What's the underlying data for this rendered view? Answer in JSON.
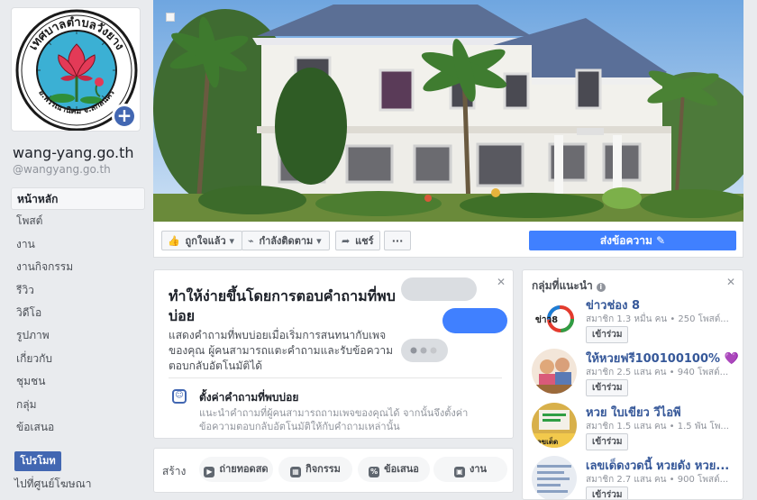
{
  "page": {
    "name": "wang-yang.go.th",
    "handle": "@wangyang.go.th",
    "logo_top_text": "เทศบาลตำบลวังยาง",
    "logo_bottom_text": "อ.พรรณานิคม จ.สกลนคร",
    "add_icon": "+"
  },
  "nav": {
    "items": [
      {
        "label": "หน้าหลัก",
        "active": true
      },
      {
        "label": "โพสต์"
      },
      {
        "label": "งาน"
      },
      {
        "label": "งานกิจกรรม"
      },
      {
        "label": "รีวิว"
      },
      {
        "label": "วิดีโอ"
      },
      {
        "label": "รูปภาพ"
      },
      {
        "label": "เกี่ยวกับ"
      },
      {
        "label": "ชุมชน"
      },
      {
        "label": "กลุ่ม"
      },
      {
        "label": "ข้อเสนอ"
      }
    ],
    "promote_label": "โปรโมท",
    "ad_center_label": "ไปที่ศูนย์โฆษณา"
  },
  "actions": {
    "like_label": "ถูกใจแล้ว",
    "follow_label": "กำลังติดตาม",
    "share_label": "แชร์",
    "more_label": "···",
    "send_message_label": "ส่งข้อความ",
    "like_icon": "👍",
    "follow_icon": "⌁",
    "share_icon": "➦",
    "send_icon": "✎",
    "dropdown_icon": "▾"
  },
  "faq": {
    "close_icon": "✕",
    "title": "ทำให้ง่ายขึ้นโดยการตอบคำถามที่พบบ่อย",
    "description": "แสดงคำถามที่พบบ่อยเมื่อเริ่มการสนทนากับเพจของคุณ ผู้คนสามารถแตะคำถามและรับข้อความตอบกลับอัตโนมัติได้",
    "sub_title": "ตั้งค่าคำถามที่พบบ่อย",
    "sub_description": "แนะนำคำถามที่ผู้คนสามารถถามเพจของคุณได้ จากนั้นจึงตั้งค่าข้อความตอบกลับอัตโนมัติให้กับคำถามเหล่านั้น",
    "chat_icon": "☺"
  },
  "create": {
    "label": "สร้าง",
    "buttons": [
      {
        "label": "ถ่ายทอดสด",
        "icon": "▶"
      },
      {
        "label": "กิจกรรม",
        "icon": "▦"
      },
      {
        "label": "ข้อเสนอ",
        "icon": "%"
      },
      {
        "label": "งาน",
        "icon": "▣"
      }
    ]
  },
  "groups": {
    "title": "กลุ่มที่แนะนำ",
    "info_icon": "i",
    "close_icon": "✕",
    "join_label": "เข้าร่วม",
    "items": [
      {
        "name": "ข่าวช่อง 8",
        "meta": "สมาชิก 1.3 หมื่น คน • 250 โพสต์...",
        "thumb_text": "ข่าว8"
      },
      {
        "name": "ให้หวยฟรี100100100% 💜 ☑",
        "meta": "สมาชิก 2.5 แสน คน • 940 โพสต์...",
        "thumb_text": ""
      },
      {
        "name": "หวย ใบเขียว วีไอพี",
        "meta": "สมาชิก 1.5 แสน คน • 1.5 พัน โพ...",
        "thumb_text": "เลขเด็ด"
      },
      {
        "name": "เลขเด็ดงวดนี้ หวยดัง หวย...",
        "meta": "สมาชิก 2.7 แสน คน • 900 โพสต์...",
        "thumb_text": ""
      }
    ]
  },
  "colors": {
    "brand_blue": "#4267b2",
    "send_blue": "#4080ff",
    "link_blue": "#365899"
  }
}
